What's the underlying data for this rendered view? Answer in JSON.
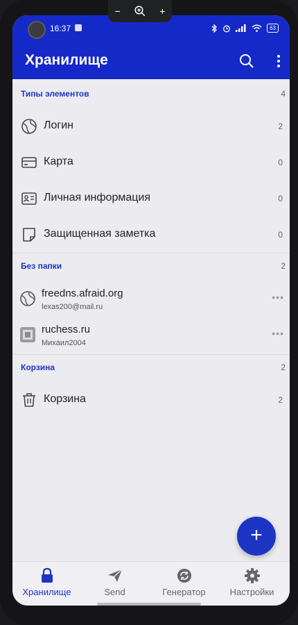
{
  "status": {
    "time": "16:37",
    "battery": "63"
  },
  "app": {
    "title": "Хранилище"
  },
  "sections": {
    "types": {
      "label": "Типы элементов",
      "count": "4"
    },
    "nofolder": {
      "label": "Без папки",
      "count": "2"
    },
    "trash": {
      "label": "Корзина",
      "count": "2"
    }
  },
  "types": [
    {
      "label": "Логин",
      "count": "2"
    },
    {
      "label": "Карта",
      "count": "0"
    },
    {
      "label": "Личная информация",
      "count": "0"
    },
    {
      "label": "Защищенная заметка",
      "count": "0"
    }
  ],
  "items": [
    {
      "name": "freedns.afraid.org",
      "user": "lexas200@mail.ru"
    },
    {
      "name": "ruchess.ru",
      "user": "Михаил2004"
    }
  ],
  "trash_row": {
    "label": "Корзина",
    "count": "2"
  },
  "nav": [
    {
      "label": "Хранилище"
    },
    {
      "label": "Send"
    },
    {
      "label": "Генератор"
    },
    {
      "label": "Настройки"
    }
  ],
  "fab_glyph": "+",
  "item_menu_glyph": "•••",
  "zoom": {
    "minus": "−",
    "plus": "+"
  },
  "colors": {
    "primary": "#1529c9",
    "accent": "#1d34c4"
  }
}
